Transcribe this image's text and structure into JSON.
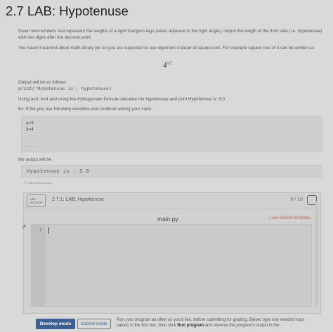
{
  "page": {
    "title": "2.7 LAB: Hypotenuse",
    "intro": "Given two numbers that represent the lengths of a right triangle's legs (sides adjacent to the right angle), output the length of the third side (i.e. hypotenuse) with two digits after the decimal point.",
    "math_note": "You haven't learned about math library yet so you are supposed to use exponent instead of square root. For example square root of 4 can be written as:",
    "math_base": "4",
    "math_exp": "1/2",
    "output_as_follows": "Output will be as follows:",
    "print_stmt": "print('Hypotenuse is', hypotenuse)",
    "using_line": "Using a=3, b=4 and using the Pythagorean formula calculate the hypotenuse and print Hypotenuse is: 5.0",
    "ex_line": "Ex: If the you use following variables and continue writing your code:",
    "code_lines": [
      "a=3",
      "b=4",
      "..."
    ],
    "output_label": "the output will be :",
    "output_value": "Hypotenuse is : 5.0",
    "tiny_id": "377756.2108908.qx3zqy7"
  },
  "lab": {
    "badge_line1": "LAB",
    "badge_line2": "ACTIVITY",
    "title": "2.7.1: LAB: Hypotenuse",
    "score": "0 / 10",
    "filename": "main.py",
    "load_template": "Load default template...",
    "line_number": "1"
  },
  "footer": {
    "develop_mode": "Develop mode",
    "submit_mode": "Submit mode",
    "note_part1": "Run your program as often as you'd like, before submitting for grading. Below, type any needed input values in the first box, then click ",
    "note_bold": "Run program",
    "note_part2": " and observe the program's output in the"
  }
}
